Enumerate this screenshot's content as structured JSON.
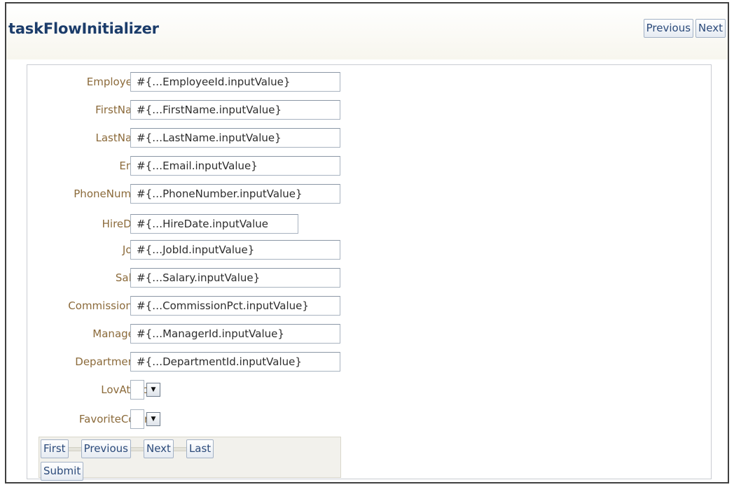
{
  "header": {
    "title": "taskFlowInitializer",
    "nav": {
      "previous_label": "Previous",
      "next_label": "Next"
    }
  },
  "form": {
    "fields": [
      {
        "label": "EmployeeId",
        "value": "#{…EmployeeId.inputValue}"
      },
      {
        "label": "FirstName",
        "value": "#{…FirstName.inputValue}"
      },
      {
        "label": "LastName",
        "value": "#{…LastName.inputValue}"
      },
      {
        "label": "Email",
        "value": "#{…Email.inputValue}"
      },
      {
        "label": "PhoneNumber",
        "value": "#{…PhoneNumber.inputValue}"
      },
      {
        "label": "HireDate",
        "value": "#{…HireDate.inputValue"
      },
      {
        "label": "JobId",
        "value": "#{…JobId.inputValue}"
      },
      {
        "label": "Salary",
        "value": "#{…Salary.inputValue}"
      },
      {
        "label": "CommissionPct",
        "value": "#{…CommissionPct.inputValue}"
      },
      {
        "label": "ManagerId",
        "value": "#{…ManagerId.inputValue}"
      },
      {
        "label": "DepartmentId",
        "value": "#{…DepartmentId.inputValue}"
      }
    ],
    "selects": [
      {
        "label": "LovAttrib",
        "value": ""
      },
      {
        "label": "FavoriteColor",
        "value": ""
      }
    ]
  },
  "record_nav": {
    "first_label": "First",
    "previous_label": "Previous",
    "next_label": "Next",
    "last_label": "Last",
    "submit_label": "Submit"
  },
  "colors": {
    "title": "#1b3c6a",
    "label": "#8b6a3a",
    "button_text": "#2b4a7a"
  },
  "icons": {
    "dropdown": "chevron-down-icon"
  }
}
